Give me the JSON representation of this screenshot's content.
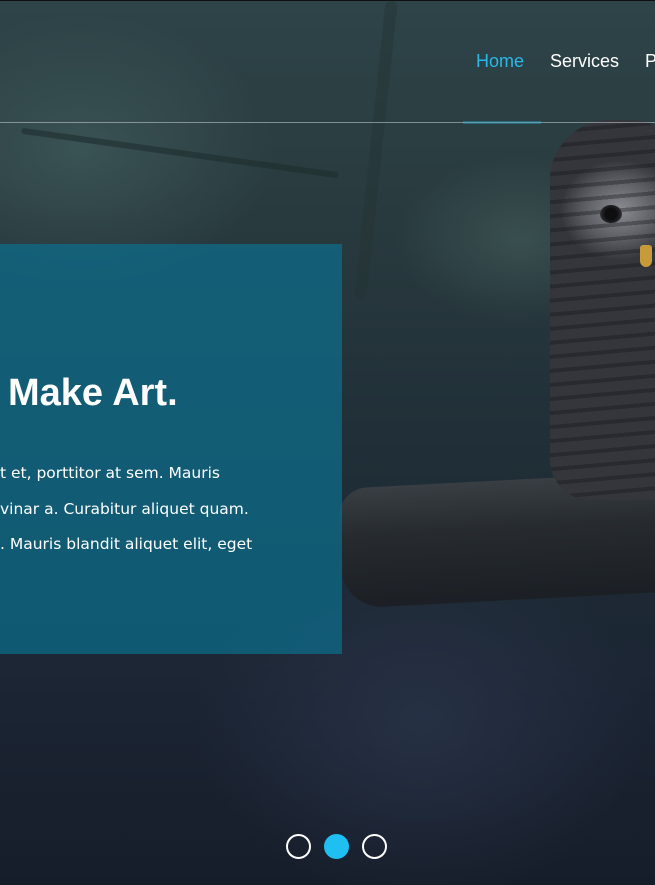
{
  "nav": {
    "items": [
      {
        "label": "Home",
        "active": true
      },
      {
        "label": "Services",
        "active": false
      },
      {
        "label": "Po",
        "active": false
      }
    ],
    "active_color": "#29b8e8"
  },
  "slide": {
    "title": "Make Art.",
    "lines": [
      "t et, porttitor at sem. Mauris",
      "vinar a. Curabitur aliquet quam.",
      ". Mauris blandit aliquet elit, eget"
    ],
    "panel_color": "#0d6e8c"
  },
  "slider": {
    "dot_count": 3,
    "active_index": 1,
    "accent_color": "#1fbff2"
  }
}
